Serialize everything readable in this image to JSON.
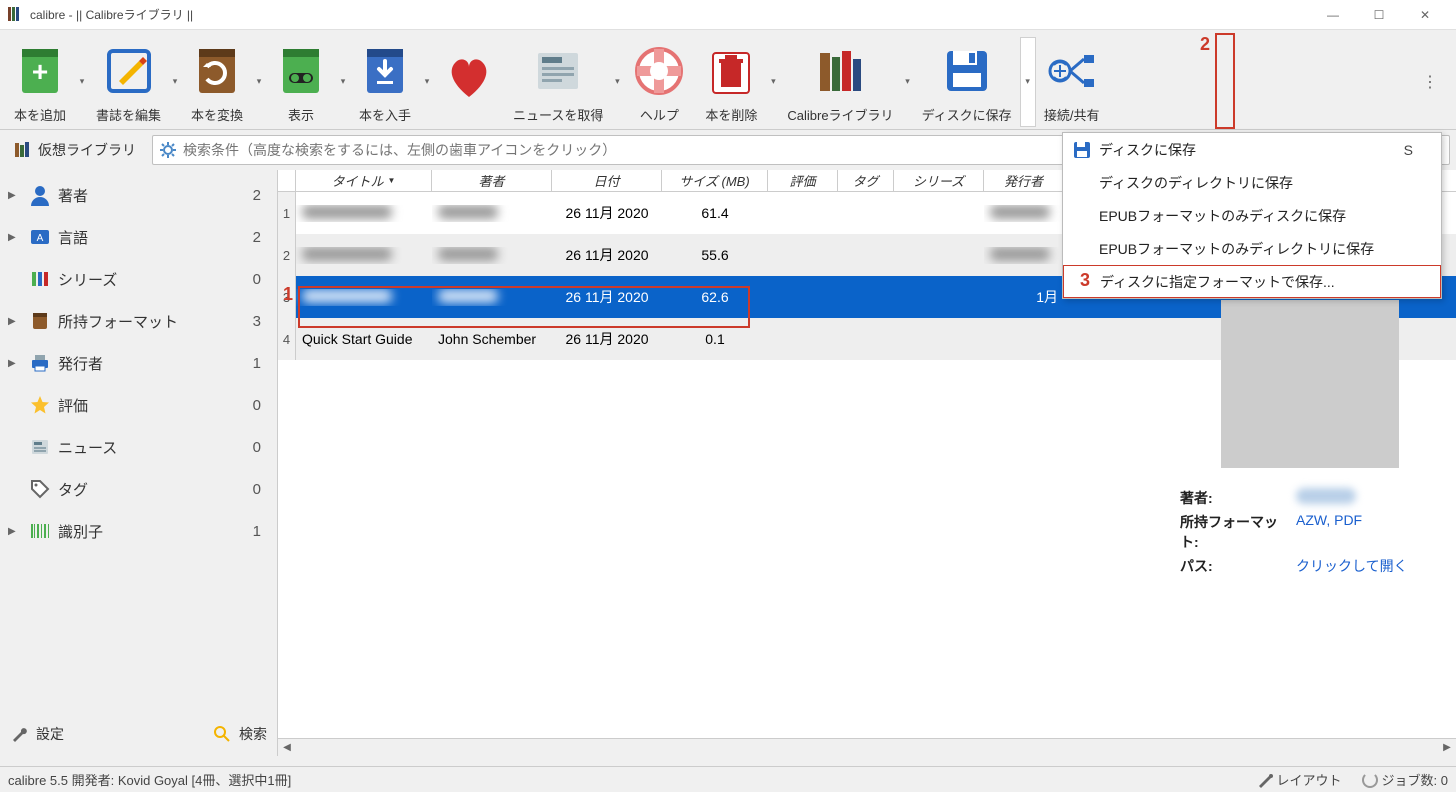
{
  "titlebar": {
    "title": "calibre - || Calibreライブラリ ||"
  },
  "toolbar": {
    "add": "本を追加",
    "edit": "書誌を編集",
    "convert": "本を変換",
    "view": "表示",
    "fetch": "本を入手",
    "news": "ニュースを取得",
    "help": "ヘルプ",
    "delete": "本を削除",
    "library": "Calibreライブラリ",
    "save": "ディスクに保存",
    "connect": "接続/共有"
  },
  "virtual_library": "仮想ライブラリ",
  "search": {
    "placeholder": "検索条件（高度な検索をするには、左側の歯車アイコンをクリック）"
  },
  "sidebar": {
    "items": [
      {
        "label": "著者",
        "count": "2",
        "expandable": true
      },
      {
        "label": "言語",
        "count": "2",
        "expandable": true
      },
      {
        "label": "シリーズ",
        "count": "0",
        "expandable": false
      },
      {
        "label": "所持フォーマット",
        "count": "3",
        "expandable": true
      },
      {
        "label": "発行者",
        "count": "1",
        "expandable": true
      },
      {
        "label": "評価",
        "count": "0",
        "expandable": false
      },
      {
        "label": "ニュース",
        "count": "0",
        "expandable": false
      },
      {
        "label": "タグ",
        "count": "0",
        "expandable": false
      },
      {
        "label": "識別子",
        "count": "1",
        "expandable": true
      }
    ],
    "settings": "設定",
    "search": "検索"
  },
  "table": {
    "headers": {
      "title": "タイトル",
      "author": "著者",
      "date": "日付",
      "size": "サイズ (MB)",
      "rating": "評価",
      "tags": "タグ",
      "series": "シリーズ",
      "publisher": "発行者"
    },
    "rows": [
      {
        "num": "1",
        "title": "",
        "author": "",
        "date": "26 11月 2020",
        "size": "61.4",
        "publisher": ""
      },
      {
        "num": "2",
        "title": "",
        "author": "",
        "date": "26 11月 2020",
        "size": "55.6",
        "publisher": ""
      },
      {
        "num": "3",
        "title": "",
        "author": "",
        "date": "26 11月 2020",
        "size": "62.6",
        "publisher": "1月",
        "selected": true
      },
      {
        "num": "4",
        "title": "Quick Start Guide",
        "author": "John Schember",
        "date": "26 11月 2020",
        "size": "0.1",
        "publisher": ""
      }
    ]
  },
  "dropdown": {
    "items": [
      {
        "label": "ディスクに保存",
        "shortcut": "S",
        "icon": true
      },
      {
        "label": "ディスクのディレクトリに保存"
      },
      {
        "label": "EPUBフォーマットのみディスクに保存"
      },
      {
        "label": "EPUBフォーマットのみディレクトリに保存"
      },
      {
        "label": "ディスクに指定フォーマットで保存...",
        "boxed": true
      }
    ]
  },
  "details": {
    "author_label": "著者:",
    "format_label": "所持フォーマット:",
    "format_value": "AZW, PDF",
    "path_label": "パス:",
    "path_value": "クリックして開く"
  },
  "annotations": {
    "a1": "1",
    "a2": "2",
    "a3": "3"
  },
  "status": {
    "left": "calibre 5.5  開発者:  Kovid Goyal    [4冊、選択中1冊]",
    "layout": "レイアウト",
    "jobs": "ジョブ数: 0"
  }
}
